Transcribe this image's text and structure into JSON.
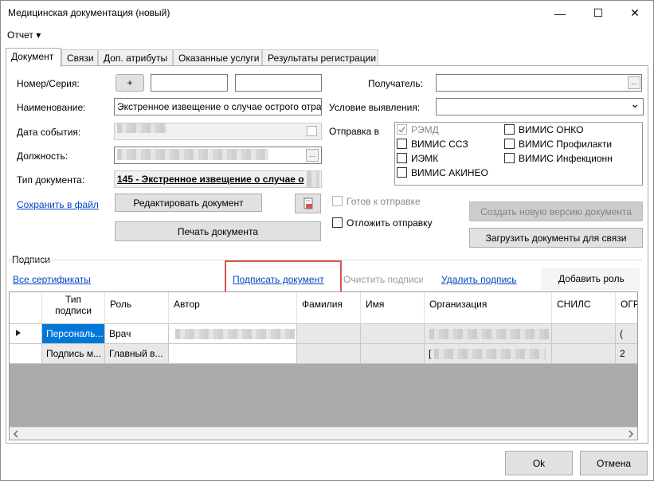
{
  "window": {
    "title": "Медицинская документация (новый)",
    "minimize": "—",
    "maximize": "☐",
    "close": "✕"
  },
  "menu": {
    "report": "Отчет ▾"
  },
  "tabs": [
    "Документ",
    "Связи",
    "Доп. атрибуты",
    "Оказанные услуги",
    "Результаты регистрации"
  ],
  "form": {
    "number_label": "Номер/Серия:",
    "number_plus": "+",
    "name_label": "Наименование:",
    "name_value": "Экстренное извещение о случае острого отра",
    "event_date_label": "Дата события:",
    "position_label": "Должность:",
    "doc_type_label": "Тип документа:",
    "doc_type_value": "145 - Экстренное извещение о случае о",
    "recipient_label": "Получатель:",
    "detection_label": "Условие выявления:",
    "send_to_label": "Отправка в",
    "ellipsis": "...",
    "dropdown_arrow": "⌄"
  },
  "send_targets": {
    "remd": "РЭМД",
    "vimis_ssz": "ВИМИС ССЗ",
    "iemk": "ИЭМК",
    "vimis_akineo": "ВИМИС АКИНЕО",
    "vimis_onko": "ВИМИС ОНКО",
    "vimis_prof": "ВИМИС Профилакти",
    "vimis_inf": "ВИМИС Инфекционн"
  },
  "actions": {
    "save_to_file": "Сохранить в файл",
    "edit_document": "Редактировать документ",
    "print_document": "Печать документа",
    "ready_to_send": "Готов к отправке",
    "postpone_send": "Отложить отправку",
    "create_version": "Создать новую версию документа",
    "load_docs": "Загрузить документы для связи"
  },
  "signatures": {
    "section_label": "Подписи",
    "all_certs": "Все сертификаты",
    "sign_document": "Подписать документ",
    "clear_signatures": "Очистить подписи",
    "delete_signature": "Удалить подпись",
    "add_role": "Добавить роль"
  },
  "grid": {
    "headers": [
      "Тип подписи",
      "Роль",
      "Автор",
      "Фамилия",
      "Имя",
      "Организация",
      "СНИЛС",
      "ОГР"
    ],
    "rows": [
      {
        "type": "Персональ...",
        "role": "Врач",
        "edge": "("
      },
      {
        "type": "Подпись м...",
        "role": "Главный в...",
        "org": "[",
        "edge": "2"
      }
    ]
  },
  "dialog": {
    "ok": "Ok",
    "cancel": "Отмена"
  },
  "colors": {
    "selected_cell": "#0078d7",
    "highlight_border": "#d9534f",
    "link": "#0645c4"
  }
}
